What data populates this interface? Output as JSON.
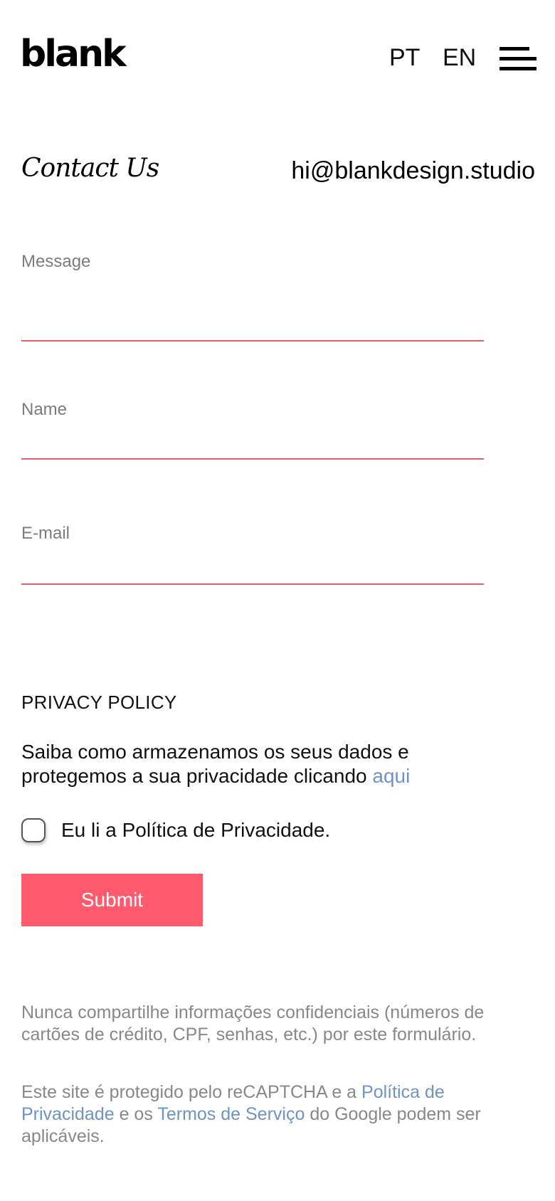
{
  "header": {
    "logo": "blank",
    "languages": [
      "PT",
      "EN"
    ]
  },
  "contact": {
    "title": "Contact Us",
    "email": "hi@blankdesign.studio"
  },
  "form": {
    "message_label": "Message",
    "name_label": "Name",
    "email_label": "E-mail",
    "message_value": "",
    "name_value": "",
    "email_value": ""
  },
  "privacy": {
    "heading": "PRIVACY POLICY",
    "text": "Saiba como armazenamos os seus dados e protegemos a sua privacidade clicando ",
    "link": "aqui",
    "checkbox_label": "Eu li a Política de Privacidade.",
    "checked": false
  },
  "submit_label": "Submit",
  "notice": {
    "confidential": "Nunca compartilhe informações confidenciais (números de cartões de crédito, CPF, senhas, etc.) por este formulário.",
    "recaptcha_prefix": "Este site é protegido pelo reCAPTCHA e a ",
    "privacy_link": "Política de Privacidade",
    "middle": " e os ",
    "terms_link": "Termos de Serviço",
    "suffix": " do Google podem ser aplicáveis."
  },
  "colors": {
    "accent": "#ff5a6d",
    "field_line": "#e0606e",
    "link": "#6d94c8",
    "muted_text": "#888888"
  }
}
